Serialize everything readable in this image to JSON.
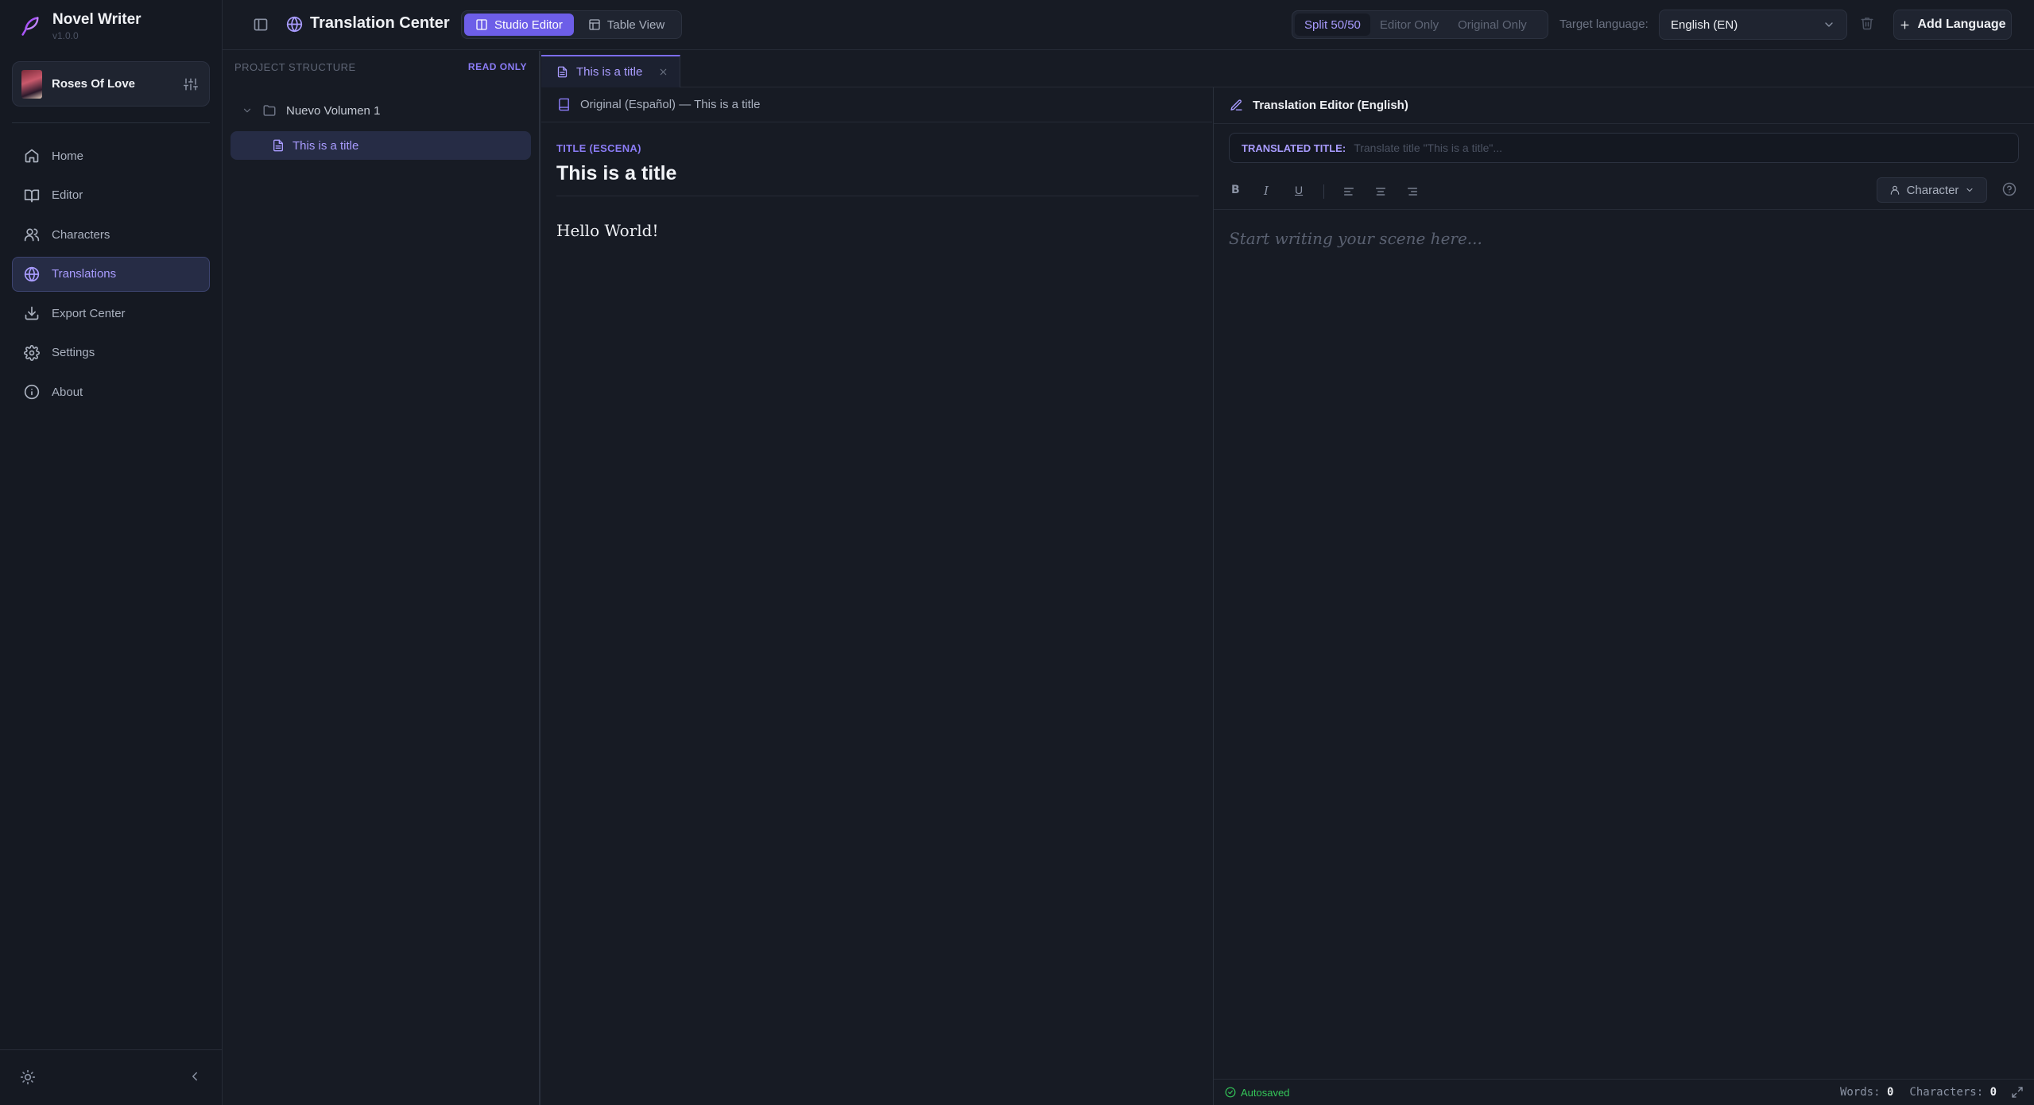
{
  "app": {
    "name": "Novel Writer",
    "version": "v1.0.0"
  },
  "project": {
    "name": "Roses Of Love"
  },
  "sidebar": {
    "items": [
      {
        "label": "Home",
        "icon": "home-icon"
      },
      {
        "label": "Editor",
        "icon": "book-icon"
      },
      {
        "label": "Characters",
        "icon": "users-icon"
      },
      {
        "label": "Translations",
        "icon": "globe-icon",
        "active": true
      },
      {
        "label": "Export Center",
        "icon": "download-icon"
      },
      {
        "label": "Settings",
        "icon": "gear-icon"
      },
      {
        "label": "About",
        "icon": "info-icon"
      }
    ]
  },
  "header": {
    "title": "Translation Center",
    "view_tabs": [
      {
        "label": "Studio Editor",
        "active": true
      },
      {
        "label": "Table View"
      }
    ],
    "layout_tabs": [
      {
        "label": "Split 50/50",
        "active": true
      },
      {
        "label": "Editor Only"
      },
      {
        "label": "Original Only"
      }
    ],
    "target_language_label": "Target language:",
    "target_language_value": "English (EN)",
    "add_language_label": "Add Language"
  },
  "structure": {
    "heading": "PROJECT STRUCTURE",
    "badge": "READ ONLY",
    "volume": "Nuevo Volumen 1",
    "scene": "This is a title"
  },
  "tabs": {
    "open_file": "This is a title"
  },
  "original": {
    "header": "Original (Español) — This is a title",
    "scene_label": "TITLE (ESCENA)",
    "scene_title": "This is a title",
    "body": "Hello World!"
  },
  "translation": {
    "header": "Translation Editor (English)",
    "title_label": "TRANSLATED TITLE:",
    "title_placeholder": "Translate title \"This is a title\"...",
    "character_button": "Character",
    "editor_placeholder": "Start writing your scene here...",
    "status": {
      "autosave": "Autosaved",
      "words_label": "Words:",
      "words": "0",
      "chars_label": "Characters:",
      "chars": "0"
    }
  },
  "colors": {
    "accent": "#6d5ee8",
    "accent_text": "#a99cff",
    "success": "#34c759",
    "background": "#171b24"
  }
}
